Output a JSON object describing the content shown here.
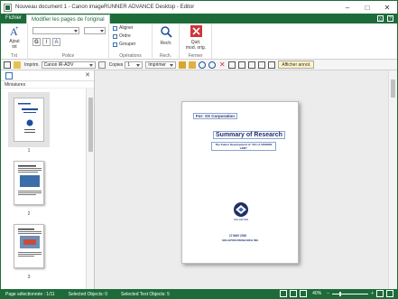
{
  "window": {
    "title": "Nouveau document 1 - Canon imageRUNNER ADVANCE Desktop - Editor"
  },
  "ribbon_tabs": [
    "Fichier",
    "Modifier les pages de l'original"
  ],
  "ribbon": {
    "text_group": {
      "button": "Ajout\ntxt",
      "label": "Txt"
    },
    "font_group": {
      "label": "Police",
      "bold": "G",
      "italic": "I",
      "color": "A"
    },
    "operations_group": {
      "items": [
        "Aligner",
        "Ordre",
        "Grouper"
      ],
      "label": "Opérations"
    },
    "search_group": {
      "button": "Rech.",
      "label": "Rech."
    },
    "close_group": {
      "button": "Quit.\nmod. orig.",
      "label": "Fermer"
    }
  },
  "command_bar": {
    "printer_label": "Imprim.",
    "printer_value": "Canon iR-ADV",
    "copies_label": "Copies",
    "copies_value": "1",
    "print_button": "Imprimer",
    "annotations_button": "Afficher annot."
  },
  "left_panel": {
    "title": "Miniatures",
    "thumbnails": [
      {
        "num": "1"
      },
      {
        "num": "2"
      },
      {
        "num": "3"
      }
    ]
  },
  "page": {
    "for_line": "For: XX Corporation",
    "title": "Summary of Research",
    "subtitle": "The Future Development of \"XX LA VISIONS LINK\"",
    "logo_text": "SOLARYEN",
    "date": "17 MAY 2010",
    "company": "SOLARYEN RESEARCH INC."
  },
  "status_bar": {
    "page_selected": "Page sélectionnée : 1/11",
    "selected_objects": "Selected Objects: 0",
    "selected_text_objects": "Selected Text Objects: 5",
    "zoom": "40%"
  },
  "colors": {
    "brand_green": "#1e6b3a",
    "accent_blue": "#1f4e9c"
  }
}
